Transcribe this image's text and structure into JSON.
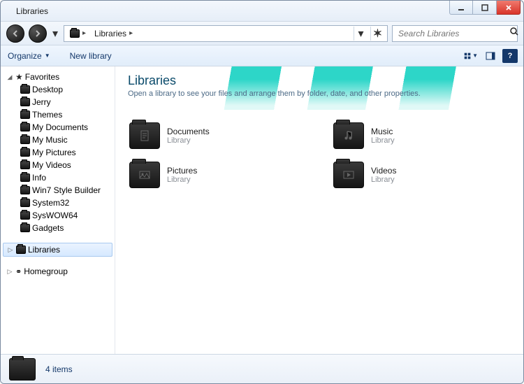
{
  "window": {
    "title": "Libraries"
  },
  "address": {
    "root_icon": "libraries",
    "segments": [
      "Libraries"
    ]
  },
  "search": {
    "placeholder": "Search Libraries"
  },
  "toolbar": {
    "organize": "Organize",
    "newlib": "New library"
  },
  "sidebar": {
    "favorites": {
      "label": "Favorites",
      "items": [
        {
          "label": "Desktop"
        },
        {
          "label": "Jerry"
        },
        {
          "label": "Themes"
        },
        {
          "label": "My Documents"
        },
        {
          "label": "My Music"
        },
        {
          "label": "My Pictures"
        },
        {
          "label": "My Videos"
        },
        {
          "label": "Info"
        },
        {
          "label": "Win7 Style Builder"
        },
        {
          "label": "System32"
        },
        {
          "label": "SysWOW64"
        },
        {
          "label": "Gadgets"
        }
      ]
    },
    "libraries": {
      "label": "Libraries"
    },
    "homegroup": {
      "label": "Homegroup"
    }
  },
  "hero": {
    "title": "Libraries",
    "subtitle": "Open a library to see your files and arrange them by folder, date, and other properties."
  },
  "items": [
    {
      "name": "Documents",
      "type": "Library",
      "icon": "doc"
    },
    {
      "name": "Music",
      "type": "Library",
      "icon": "music"
    },
    {
      "name": "Pictures",
      "type": "Library",
      "icon": "pic"
    },
    {
      "name": "Videos",
      "type": "Library",
      "icon": "vid"
    }
  ],
  "status": {
    "count_text": "4 items"
  }
}
